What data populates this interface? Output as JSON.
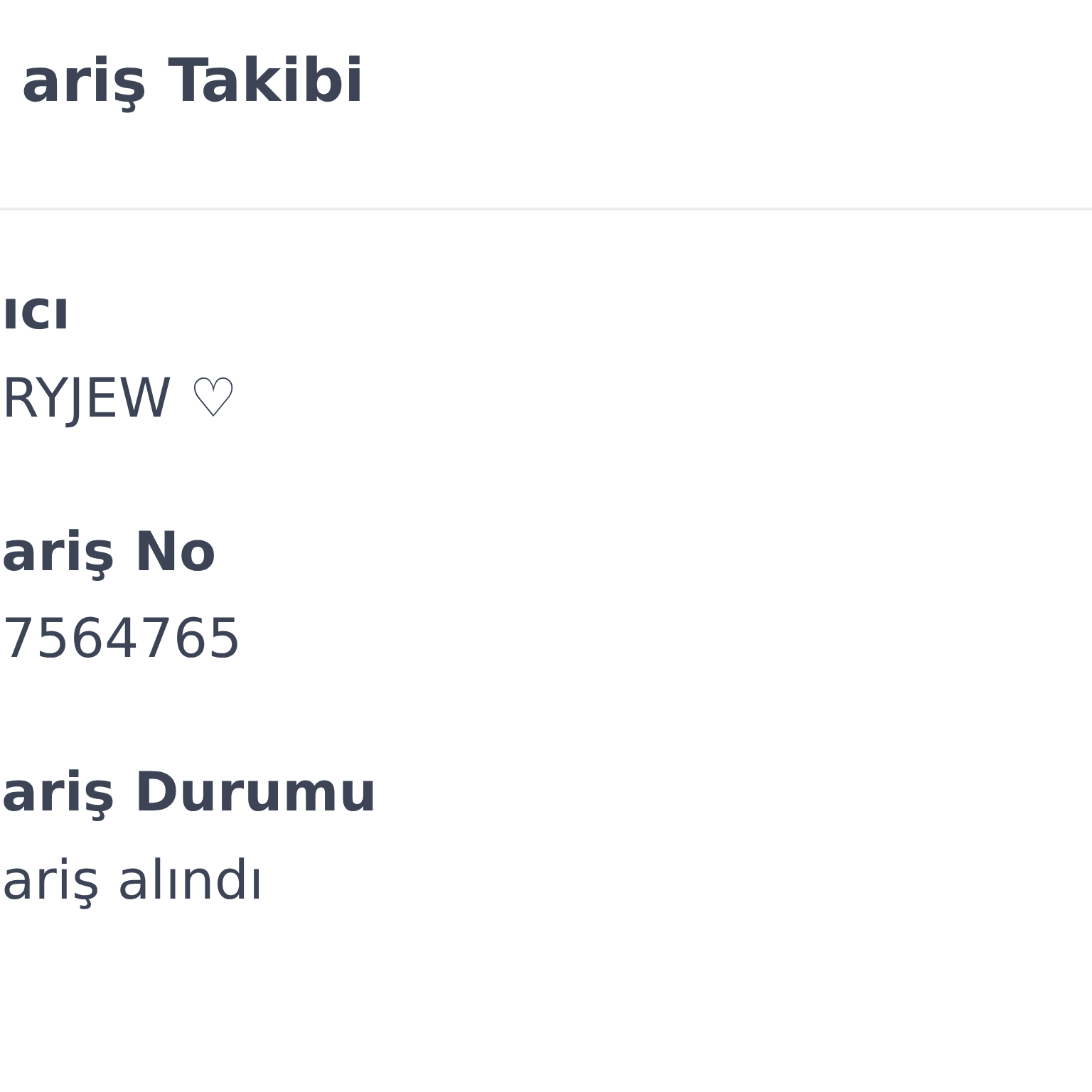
{
  "header": {
    "title": "ariş Takibi"
  },
  "fields": [
    {
      "label": "ıcı",
      "value": "RYJEW ♡"
    },
    {
      "label": "ariş No",
      "value": "7564765"
    },
    {
      "label": "ariş Durumu",
      "value": "ariş alındı"
    }
  ]
}
